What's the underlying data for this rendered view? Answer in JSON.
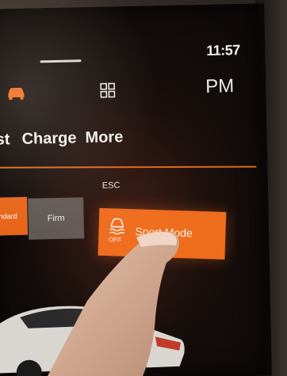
{
  "status_bar": {
    "time": "11:57"
  },
  "top_row": {
    "left_icon": "car-icon",
    "center_icon": "grid-icon",
    "ampm": "PM"
  },
  "tabs": [
    {
      "label": "st"
    },
    {
      "label": "Charge"
    },
    {
      "label": "More"
    }
  ],
  "suspension": {
    "standard_label": "ndard",
    "firm_label": "Firm"
  },
  "esc": {
    "section_label": "ESC",
    "icon": "esc-off-icon",
    "icon_caption": "OFF",
    "button_label": "Sport Mode"
  },
  "colors": {
    "accent": "#ee6d1c",
    "inactive_button": "#5c5957",
    "text": "#f1f1f1"
  }
}
